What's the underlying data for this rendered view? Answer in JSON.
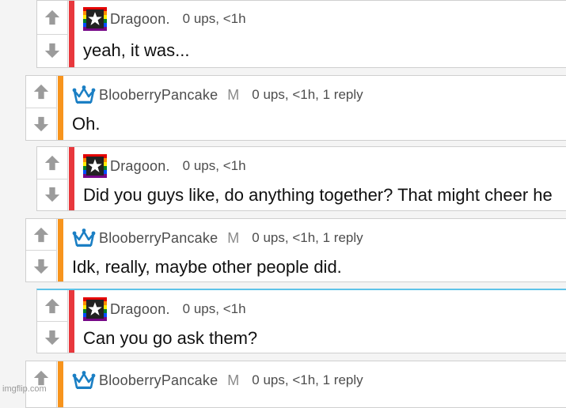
{
  "colors": {
    "dragoon_accent": "#e8383d",
    "blooberry_accent": "#f7941d",
    "vote_arrow": "#9b9b9b",
    "highlight_border": "#5ec3e8",
    "crown": "#1b7fc4"
  },
  "comments": [
    {
      "username": "Dragoon.",
      "mod": "",
      "info": "0 ups, <1h",
      "text": "yeah, it was...",
      "badge_icon": "rainbow-star-badge-icon"
    },
    {
      "username": "BlooberryPancake",
      "mod": "M",
      "info": "0 ups, <1h, 1 reply",
      "text": "Oh.",
      "badge_icon": "crown-icon"
    },
    {
      "username": "Dragoon.",
      "mod": "",
      "info": "0 ups, <1h",
      "text": "Did you guys like, do anything together? That might cheer he",
      "badge_icon": "rainbow-star-badge-icon"
    },
    {
      "username": "BlooberryPancake",
      "mod": "M",
      "info": "0 ups, <1h, 1 reply",
      "text": "Idk, really, maybe other people did.",
      "badge_icon": "crown-icon"
    },
    {
      "username": "Dragoon.",
      "mod": "",
      "info": "0 ups, <1h",
      "text": "Can you go ask them?",
      "badge_icon": "rainbow-star-badge-icon"
    },
    {
      "username": "BlooberryPancake",
      "mod": "M",
      "info": "0 ups, <1h, 1 reply",
      "text": "",
      "badge_icon": "crown-icon"
    }
  ],
  "watermark": "imgflip.com"
}
